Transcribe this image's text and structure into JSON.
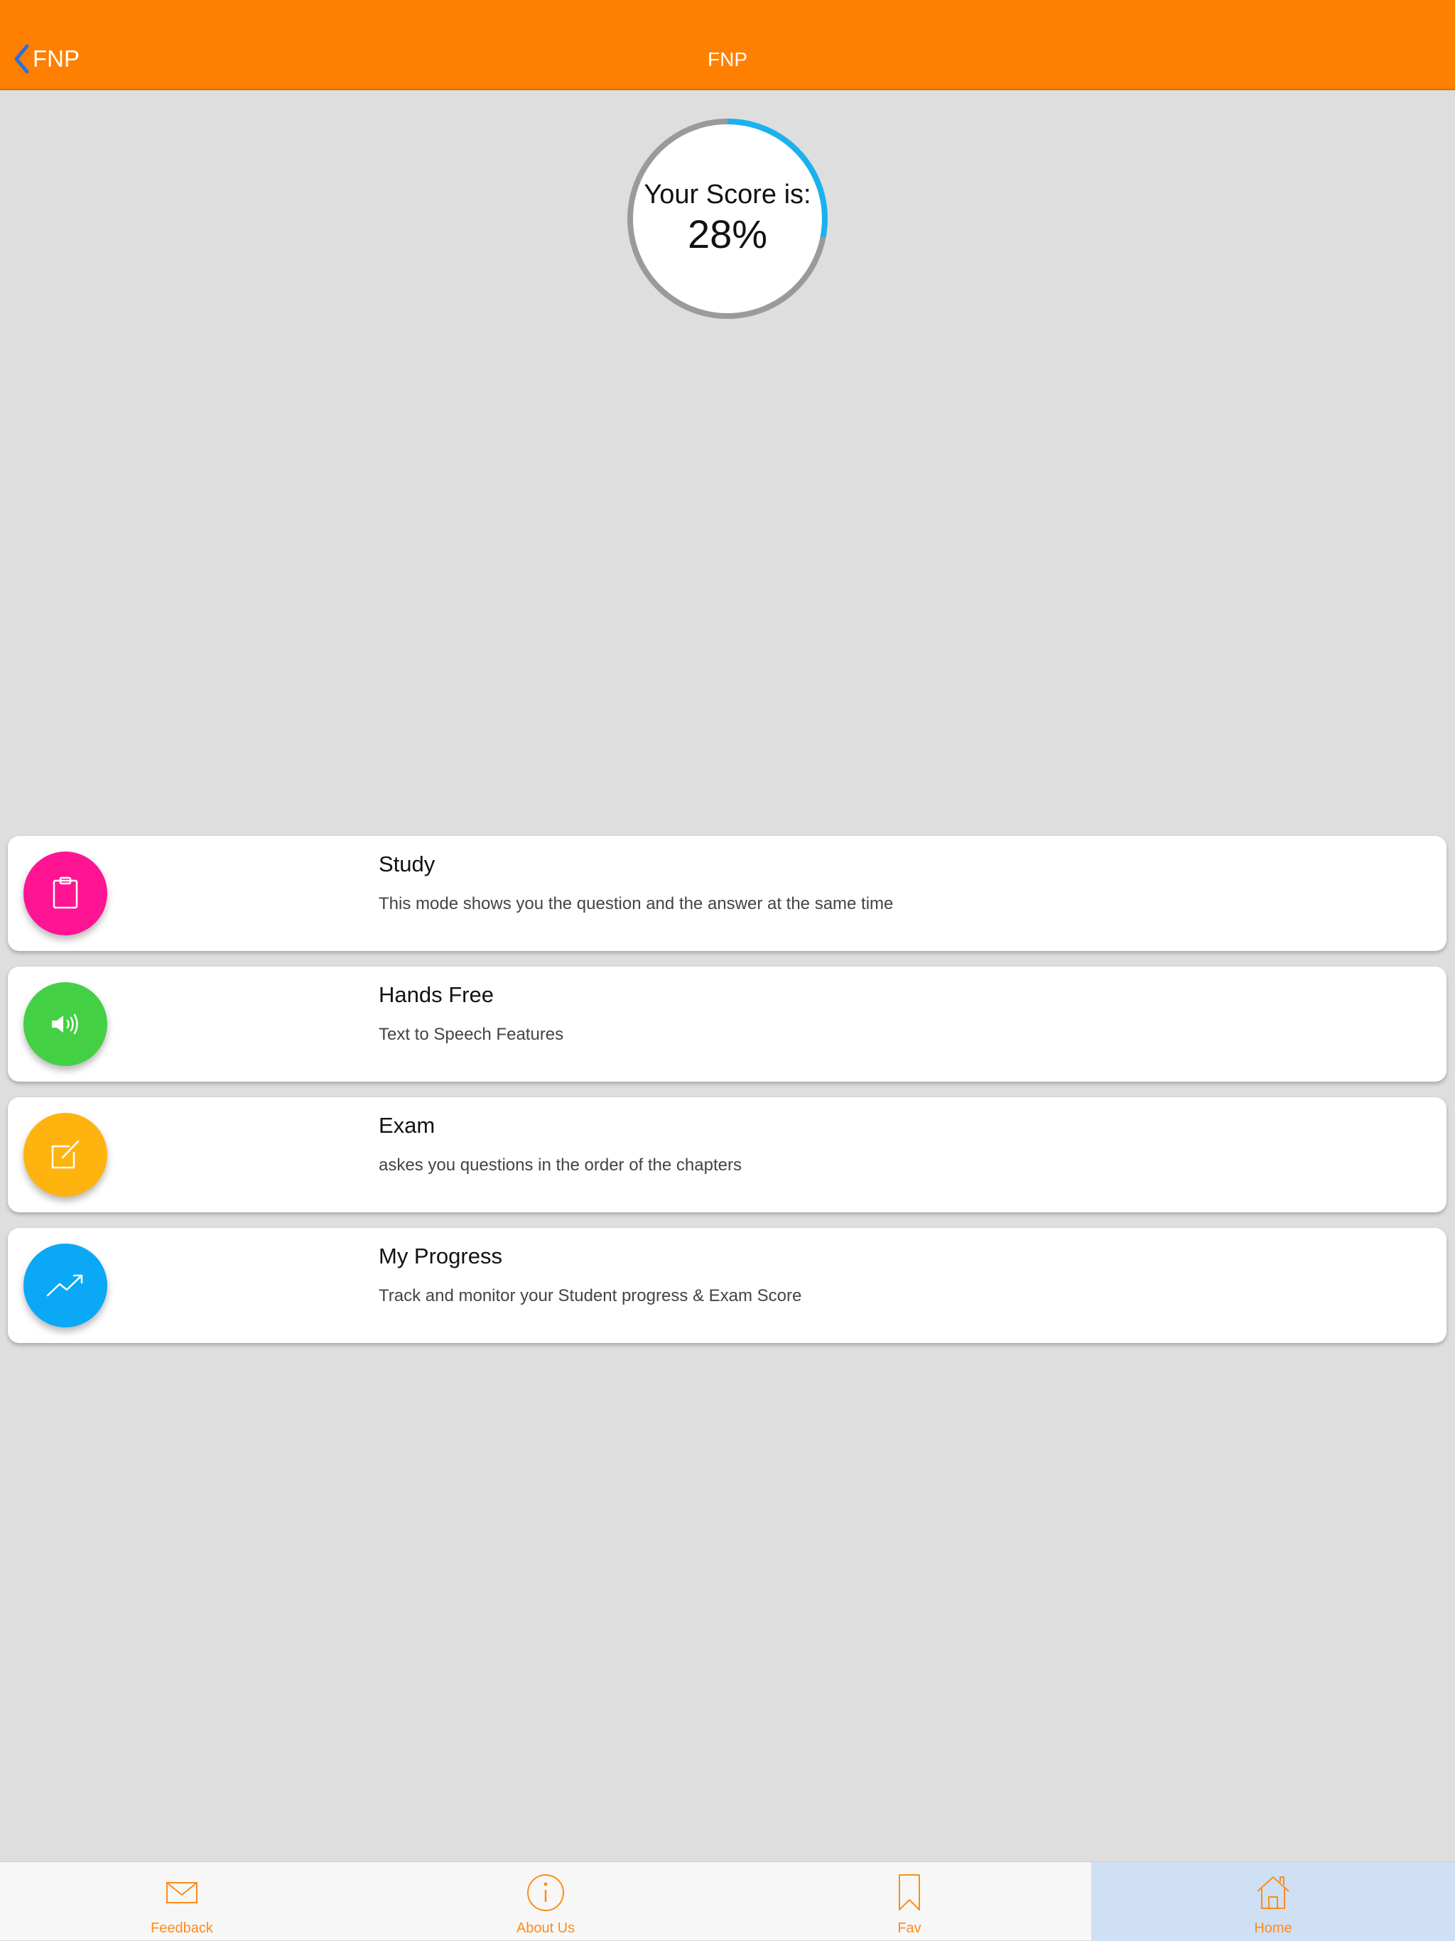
{
  "nav": {
    "back_label": "FNP",
    "title": "FNP"
  },
  "score": {
    "label": "Your Score is:",
    "value_text": "28%",
    "fraction": 0.28
  },
  "modes": [
    {
      "title": "Study",
      "description": "This mode shows you the question and the answer at the same time",
      "icon": "clipboard-icon",
      "color": "#ff1493"
    },
    {
      "title": "Hands Free",
      "description": "Text to Speech Features",
      "icon": "speaker-icon",
      "color": "#44d044"
    },
    {
      "title": "Exam",
      "description": "askes you questions in the order of the chapters",
      "icon": "edit-icon",
      "color": "#ffb30f"
    },
    {
      "title": "My Progress",
      "description": "Track and monitor your Student progress & Exam Score",
      "icon": "trending-up-icon",
      "color": "#0aa8f5"
    }
  ],
  "tabs": [
    {
      "label": "Feedback",
      "icon": "envelope-icon"
    },
    {
      "label": "About Us",
      "icon": "info-icon"
    },
    {
      "label": "Fav",
      "icon": "bookmark-icon"
    },
    {
      "label": "Home",
      "icon": "home-icon",
      "active": true
    }
  ],
  "colors": {
    "nav_background": "#ff8000",
    "page_background": "#dedede",
    "score_progress": "#1ab2ee",
    "score_track": "#9a9a9a",
    "back_chevron": "#2a6fe0",
    "tab_accent": "#ff8c1a",
    "active_tab_background": "#cfe0f5"
  }
}
